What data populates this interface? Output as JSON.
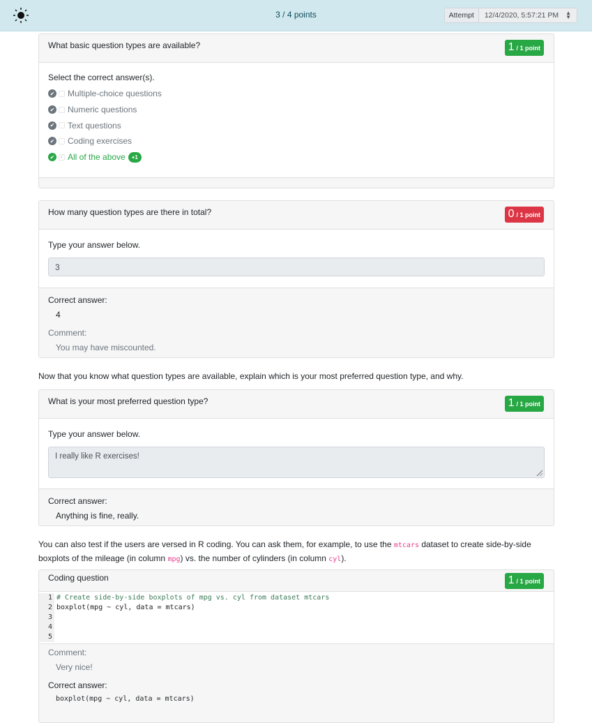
{
  "header": {
    "theme_icon": "sun-icon",
    "score": "3 / 4 points",
    "attempt_label": "Attempt",
    "attempt_value": "12/4/2020, 5:57:21 PM"
  },
  "q1": {
    "title": "What basic question types are available?",
    "score": "1",
    "max": "/ 1 point",
    "instruction": "Select the correct answer(s).",
    "options": [
      {
        "label": "Multiple-choice questions"
      },
      {
        "label": "Numeric questions"
      },
      {
        "label": "Text questions"
      },
      {
        "label": "Coding exercises"
      },
      {
        "label": "All of the above",
        "badge": "+1"
      }
    ]
  },
  "q2": {
    "title": "How many question types are there in total?",
    "score": "0",
    "max": "/ 1 point",
    "instruction": "Type your answer below.",
    "answer": "3",
    "correct_label": "Correct answer:",
    "correct_value": "4",
    "comment_label": "Comment:",
    "comment_value": "You may have miscounted."
  },
  "para1": "Now that you know what question types are available, explain which is your most preferred question type, and why.",
  "q3": {
    "title": "What is your most preferred question type?",
    "score": "1",
    "max": "/ 1 point",
    "instruction": "Type your answer below.",
    "answer": "I really like R exercises!",
    "correct_label": "Correct answer:",
    "correct_value": "Anything is fine, really."
  },
  "para2": {
    "p1": "You can also test if the users are versed in R coding. You can ask them, for example, to use the ",
    "c1": "mtcars",
    "p2": " dataset to create side-by-side boxplots of the mileage (in column ",
    "c2": "mpg",
    "p3": ") vs. the number of cylinders (in column ",
    "c3": "cyl",
    "p4": ")."
  },
  "q4": {
    "title": "Coding question",
    "score": "1",
    "max": "/ 1 point",
    "code_lines": [
      {
        "n": "1",
        "text": "# Create side-by-side boxplots of mpg vs. cyl from dataset mtcars"
      },
      {
        "n": "2",
        "text": "boxplot(mpg ~ cyl, data = mtcars)"
      },
      {
        "n": "3",
        "text": ""
      },
      {
        "n": "4",
        "text": ""
      },
      {
        "n": "5",
        "text": ""
      }
    ],
    "comment_label": "Comment:",
    "comment_value": "Very nice!",
    "correct_label": "Correct answer:",
    "correct_value": "boxplot(mpg ~ cyl, data = mtcars)"
  }
}
